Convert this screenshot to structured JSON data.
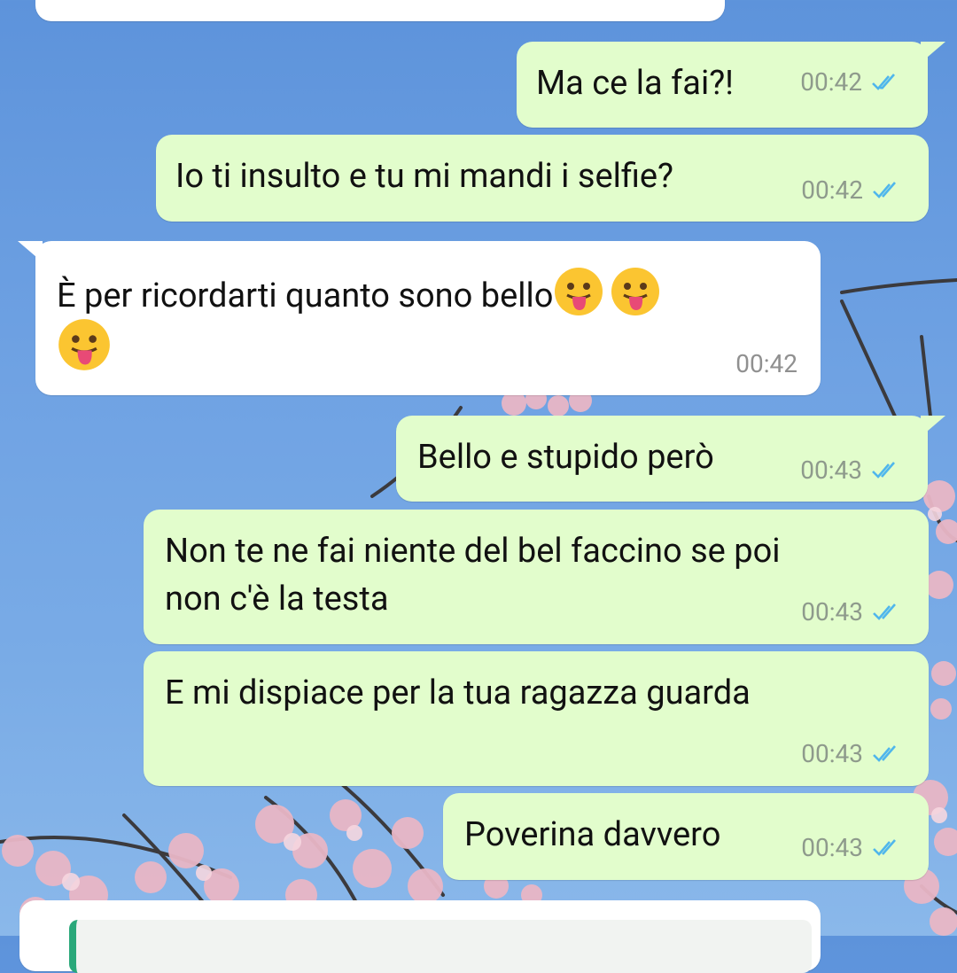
{
  "messages": [
    {
      "id": "m1",
      "direction": "out",
      "text": "Ma ce la fai?!",
      "time": "00:42",
      "status": "read"
    },
    {
      "id": "m2",
      "direction": "out",
      "text": "Io ti insulto e tu mi mandi i selfie?",
      "time": "00:42",
      "status": "read"
    },
    {
      "id": "m3",
      "direction": "in",
      "text": "È per ricordarti quanto sono bello",
      "emoji": [
        "face-with-tongue",
        "face-with-tongue",
        "face-with-tongue"
      ],
      "time": "00:42"
    },
    {
      "id": "m4",
      "direction": "out",
      "text": "Bello e stupido però",
      "time": "00:43",
      "status": "read"
    },
    {
      "id": "m5",
      "direction": "out",
      "lines": [
        "Non te ne fai niente del bel faccino se poi",
        "non c'è la testa"
      ],
      "time": "00:43",
      "status": "read"
    },
    {
      "id": "m6",
      "direction": "out",
      "text": "E mi dispiace per la tua ragazza guarda",
      "time": "00:43",
      "status": "read"
    },
    {
      "id": "m7",
      "direction": "out",
      "text": "Poverina davvero",
      "time": "00:43",
      "status": "read"
    }
  ],
  "colors": {
    "outgoing_bubble": "#e2fdcc",
    "incoming_bubble": "#ffffff",
    "read_ticks": "#4fb6ec",
    "wallpaper_sky": "#6fa2e3",
    "blossom": "#e9b7c6"
  }
}
